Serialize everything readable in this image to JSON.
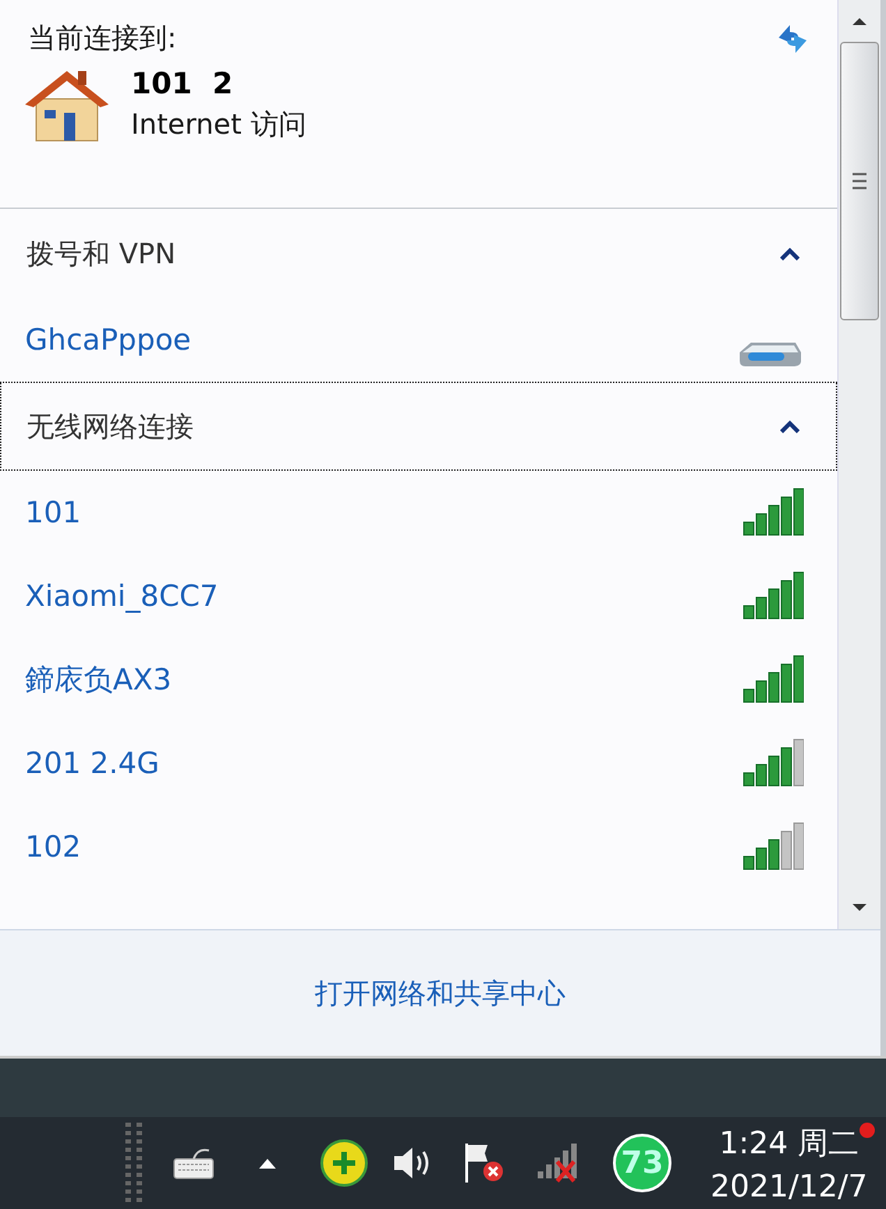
{
  "current": {
    "heading": "当前连接到:",
    "network": {
      "name": "101  2",
      "access": "Internet 访问"
    }
  },
  "sections": [
    {
      "title": "拨号和 VPN",
      "expanded": true,
      "focused": false,
      "items": [
        {
          "kind": "dialup",
          "name": "GhcaPppoe"
        }
      ]
    },
    {
      "title": "无线网络连接",
      "expanded": true,
      "focused": true,
      "items": [
        {
          "kind": "wifi",
          "name": "101",
          "level": 1
        },
        {
          "kind": "wifi",
          "name": "Xiaomi_8CC7",
          "level": 1
        },
        {
          "kind": "wifi",
          "name": "鍗庡负AX3",
          "level": 1
        },
        {
          "kind": "wifi",
          "name": "201 2.4G",
          "level": 0.8
        },
        {
          "kind": "wifi",
          "name": "102",
          "level": 0.6
        }
      ]
    }
  ],
  "footer_link": "打开网络和共享中心",
  "taskbar": {
    "badge": "73",
    "time": "1:24 周二",
    "date": "2021/12/7"
  }
}
